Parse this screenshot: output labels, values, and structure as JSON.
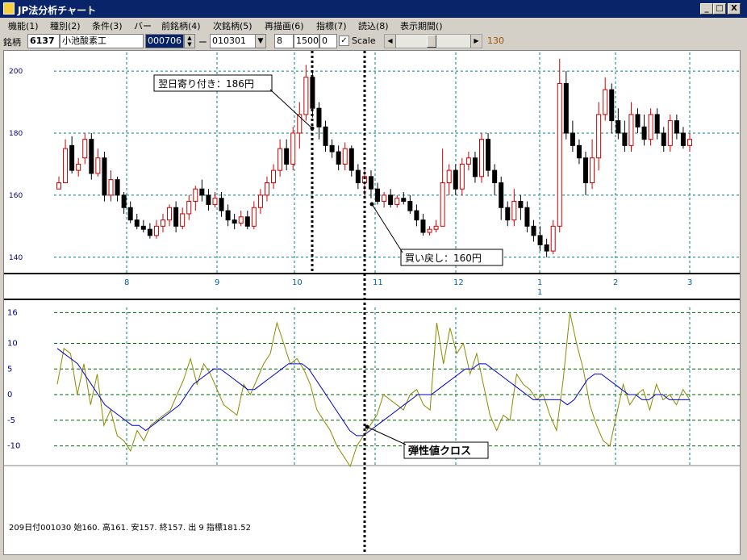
{
  "window": {
    "title": "JP法分析チャート",
    "minimize": "_",
    "maximize": "□",
    "close": "X"
  },
  "menu": [
    "機能(1)",
    "種別(2)",
    "条件(3)",
    "バー",
    "前銘柄(4)",
    "次銘柄(5)",
    "再描画(6)",
    "指標(7)",
    "読込(8)",
    "表示期間()"
  ],
  "toolbar": {
    "label": "銘柄",
    "code": "6137",
    "name": "小池酸素工",
    "date": "000706",
    "dash": "ー",
    "range_date": "010301",
    "param1": "8",
    "param2": "1500",
    "param3": "0",
    "scale_checked": true,
    "scale_label": "Scale",
    "slider_value": "130"
  },
  "chart_data": {
    "type": "candlestick",
    "price_axis": {
      "ticks": [
        140,
        160,
        180,
        200
      ],
      "ylim": [
        135,
        206
      ]
    },
    "month_labels": [
      "8",
      "9",
      "10",
      "11",
      "12",
      "1",
      "2",
      "3"
    ],
    "year_label": "1",
    "oscillator_axis": {
      "ticks": [
        16,
        10,
        5,
        0,
        -5,
        -10
      ],
      "ylim": [
        -14,
        17
      ]
    },
    "annotations": {
      "next_open": "翌日寄り付き：186円",
      "buyback": "買い戻し：160円",
      "cross": "弾性値クロス"
    },
    "colors": {
      "up": "#cc0000",
      "down": "#000000",
      "grid_price": "#008080",
      "grid_osc": "#006400",
      "osc_fast": "#8b8b00",
      "osc_slow": "#0000cc",
      "label_blue": "#000080",
      "month_label": "#0060a0"
    }
  },
  "status": {
    "readout": "209日付001030 始160. 高161. 安157. 終157. 出 9 指標181.52"
  }
}
